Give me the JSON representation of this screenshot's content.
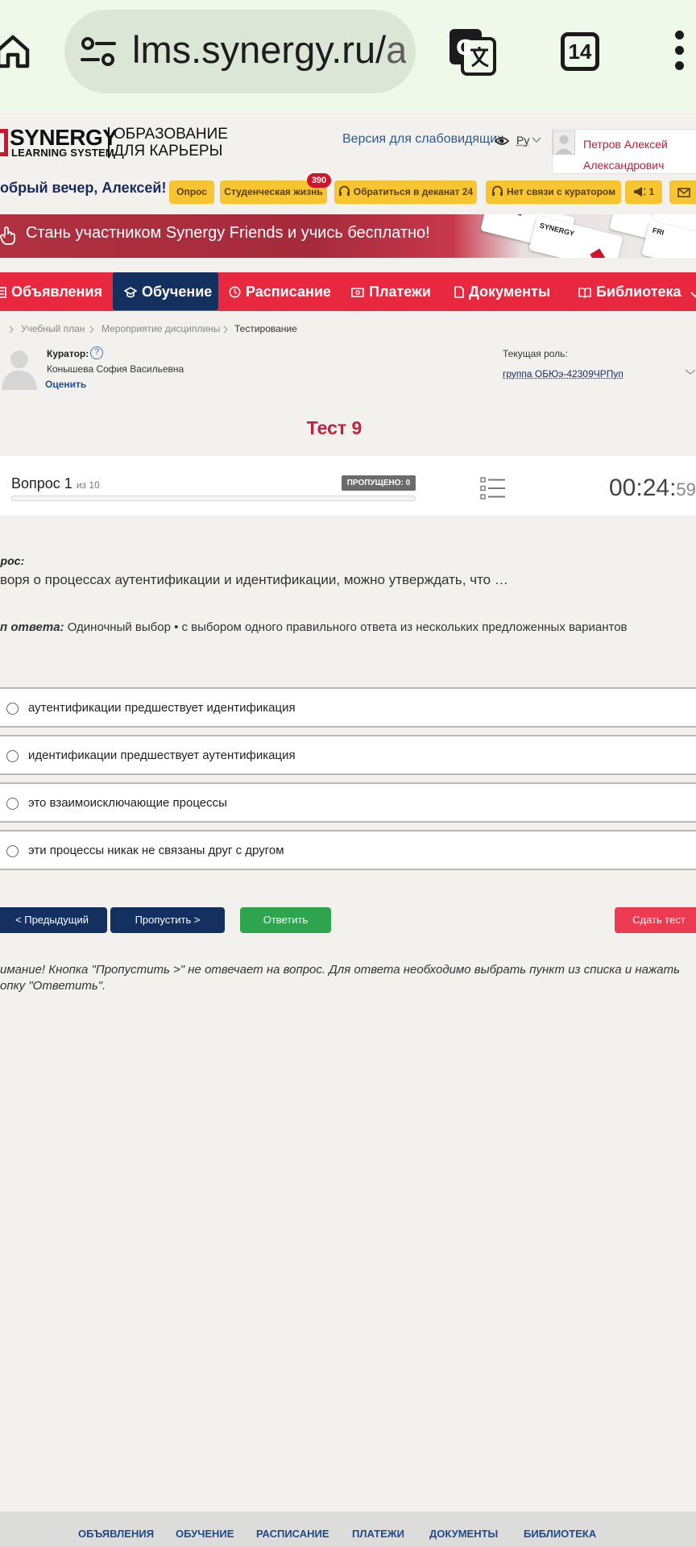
{
  "browser": {
    "url_main": "lms.synergy.ru/",
    "url_rest": "as",
    "tab_count": "14"
  },
  "header": {
    "logo_synergy": "SYNERGY",
    "logo_ls": "LEARNING SYSTEM",
    "logo_edu_line1": "ОБРАЗОВАНИЕ",
    "logo_edu_line2": "ДЛЯ КАРЬЕРЫ",
    "accessibility_link": "Версия для слабовидящих",
    "lang": "Ру",
    "user_name": "Петров Алексей Александрович",
    "greeting": "обрый вечер, Алексей!",
    "pills": {
      "survey": "Опрос",
      "student_life": "Студенческая жизнь",
      "student_life_badge": "390",
      "dean": "Обратиться в деканат 24",
      "curator": "Нет связи с куратором",
      "announce": "1"
    }
  },
  "banner": {
    "text": "Стань участником Synergy Friends и учись бесплатно!"
  },
  "nav": {
    "announcements": "Объявления",
    "learning": "Обучение",
    "schedule": "Расписание",
    "payments": "Платежи",
    "documents": "Документы",
    "library": "Библиотека"
  },
  "breadcrumb": {
    "plan": "Учебный план",
    "event": "Мероприятие дисциплины",
    "current": "Тестирование"
  },
  "curator": {
    "label": "Куратор:",
    "help": "?",
    "name": "Конышева София Васильевна",
    "rate": "Оценить"
  },
  "role": {
    "label": "Текущая роль:",
    "value": "группа ОБЮэ-42309ЧРПуп"
  },
  "test": {
    "title": "Тест 9",
    "question_label": "Вопрос 1",
    "question_of": "из 10",
    "skipped": "ПРОПУЩЕНО: 0",
    "progress": 0,
    "timer_main": "00:24:",
    "timer_sec": "59",
    "question_heading": "прос:",
    "question_text": "воря о процессах аутентификации и идентификации, можно утверждать, что …",
    "answer_type_label": "п ответа:",
    "answer_type_text": " Одиночный выбор • с выбором одного правильного ответа из нескольких предложенных вариантов",
    "options": [
      "аутентификации предшествует идентификация",
      "идентификации предшествует аутентификация",
      "это взаимоисключающие процессы",
      "эти процессы никак не связаны друг с другом"
    ]
  },
  "buttons": {
    "prev": "< Предыдущий",
    "skip": "Пропустить >",
    "answer": "Ответить",
    "submit": "Сдать тест"
  },
  "note": "имание! Кнопка \"Пропустить >\" не отвечает на вопрос. Для ответа необходимо выбрать пункт из списка и нажать опку \"Ответить\".",
  "footer": {
    "announcements": "ОБЪЯВЛЕНИЯ",
    "learning": "ОБУЧЕНИЕ",
    "schedule": "РАСПИСАНИЕ",
    "payments": "ПЛАТЕЖИ",
    "documents": "ДОКУМЕНТЫ",
    "library": "БИБЛИОТЕКА"
  },
  "colors": {
    "brand_red": "#e8283e",
    "nav_active": "#14305f",
    "pill_yellow": "#f6c531",
    "answer_green": "#2ea44f",
    "submit_red": "#ec3a50"
  }
}
